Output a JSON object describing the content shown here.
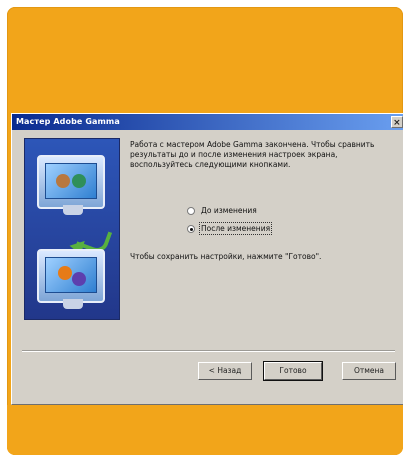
{
  "dialog": {
    "title": "Мастер Adobe Gamma",
    "close_glyph": "×",
    "intro_text": "Работа с мастером Adobe Gamma закончена. Чтобы сравнить результаты до и после изменения настроек экрана, воспользуйтесь следующими кнопками.",
    "options": [
      {
        "label": "До изменения",
        "selected": false
      },
      {
        "label": "После изменения",
        "selected": true
      }
    ],
    "save_note": "Чтобы сохранить настройки, нажмите \"Готово\".",
    "buttons": {
      "back": "< Назад",
      "done": "Готово",
      "cancel": "Отмена"
    }
  },
  "colors": {
    "accent_orange": "#f2a51a",
    "titlebar_start": "#0a2a8f",
    "titlebar_end": "#6a9ff0",
    "dialog_bg": "#d4d0c8"
  },
  "icons": {
    "illustration": "monitor-comparison-illustration"
  }
}
